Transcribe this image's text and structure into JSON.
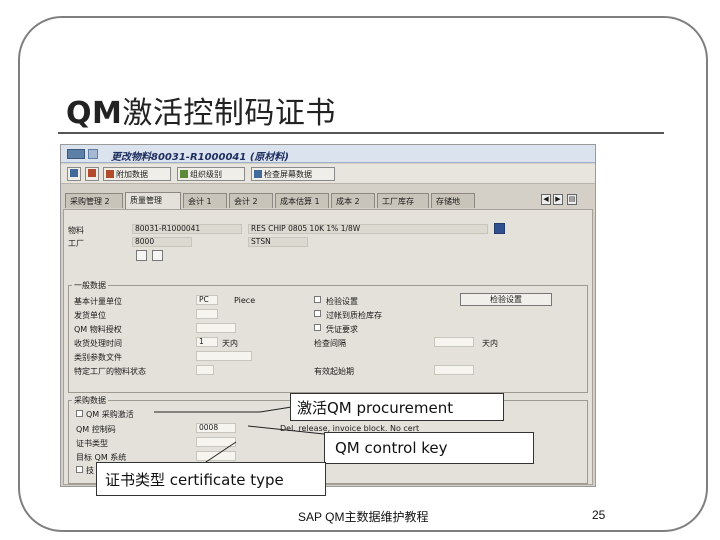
{
  "slide": {
    "title_prefix": "QM",
    "title_main": "激活控制码证书",
    "footer": "SAP QM主数据维护教程",
    "page_number": "25"
  },
  "sap": {
    "window_title": "更改物料80031-R1000041 (原材料)",
    "toolbar": {
      "additional_data": "附加数据",
      "org_levels": "组织级别",
      "check_screen_data": "检查屏幕数据"
    },
    "tabs": [
      "采购管理 2",
      "质量管理",
      "会计 1",
      "会计 2",
      "成本估算 1",
      "成本 2",
      "工厂库存",
      "存储地"
    ],
    "material_label": "物料",
    "material_value": "80031-R1000041",
    "material_desc": "RES CHIP 0805 10K 1% 1/8W",
    "plant_label": "工厂",
    "plant_value": "8000",
    "plant_desc": "STSN",
    "general": {
      "title": "一般数据",
      "fields": {
        "base_unit": "基本计量单位",
        "base_unit_value": "PC",
        "base_unit_desc": "Piece",
        "issue_unit": "发货单位",
        "qm_material_auth": "QM 物料授权",
        "gr_processing_time": "收货处理时间",
        "gr_value": "1",
        "gr_unit": "天内",
        "catalog_profile": "类别参数文件",
        "inspection_setup": "检验设置",
        "post_to_insp_stock": "过帐到质检库存",
        "doc_required": "凭证要求",
        "inspection_interval": "检查间隔",
        "interval_unit": "天内",
        "special_log": "特定工厂的物料状态",
        "valid_from": "有效起始期"
      },
      "inspection_button": "检验设置"
    },
    "procurement": {
      "title": "采购数据",
      "qm_proc_active": "QM 采购激活",
      "qm_control_key": "QM 控制码",
      "control_key_value": "0008",
      "control_key_desc": "Del. release, invoice block. No cert",
      "cert_type": "证书类型",
      "target_qm_system": "目标 QM 系统",
      "more": "技"
    }
  },
  "callouts": {
    "procurement": "激活QM procurement",
    "control_key": "QM control key",
    "cert_type": "证书类型 certificate type"
  },
  "colors": {
    "sap_bg": "#d4d0c8",
    "sap_panel": "#e4e1da",
    "title_bar": "#dbe3ee"
  }
}
